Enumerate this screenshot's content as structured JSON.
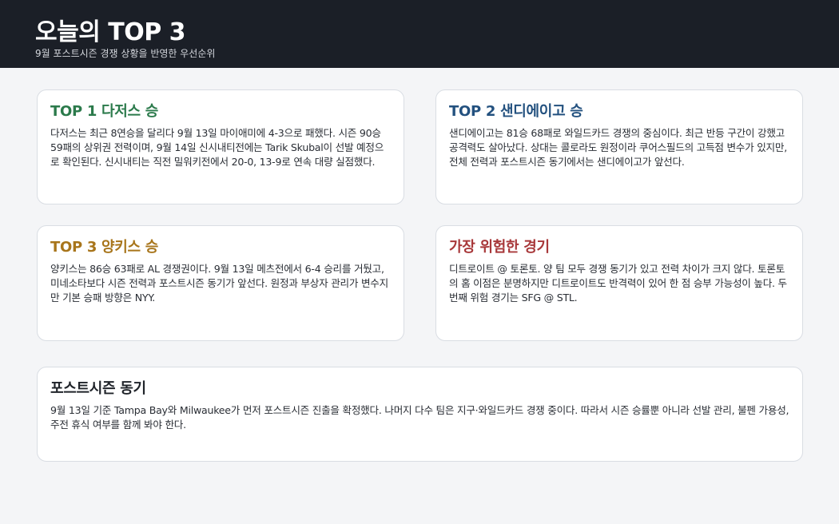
{
  "header": {
    "title": "오늘의 TOP 3",
    "subtitle": "9월 포스트시즌 경쟁 상황을 반영한 우선순위"
  },
  "cards": [
    {
      "title": "TOP 1  다저스 승",
      "body": "다저스는 최근 8연승을 달리다 9월 13일 마이애미에 4-3으로 패했다. 시즌 90승 59패의 상위권 전력이며, 9월 14일 신시내티전에는 Tarik Skubal이 선발 예정으로 확인된다. 신시내티는 직전 밀워키전에서 20-0, 13-9로 연속 대량 실점했다."
    },
    {
      "title": "TOP 2  샌디에이고 승",
      "body": "샌디에이고는 81승 68패로 와일드카드 경쟁의 중심이다. 최근 반등 구간이 강했고 공격력도 살아났다. 상대는 콜로라도 원정이라 쿠어스필드의 고득점 변수가 있지만, 전체 전력과 포스트시즌 동기에서는 샌디에이고가 앞선다."
    },
    {
      "title": "TOP 3  양키스 승",
      "body": "양키스는 86승 63패로 AL 경쟁권이다. 9월 13일 메츠전에서 6-4 승리를 거뒀고, 미네소타보다 시즌 전력과 포스트시즌 동기가 앞선다. 원정과 부상자 관리가 변수지만 기본 승패 방향은 NYY."
    },
    {
      "title": "가장 위험한 경기",
      "body": "디트로이트 @ 토론토. 양 팀 모두 경쟁 동기가 있고 전력 차이가 크지 않다. 토론토의 홈 이점은 분명하지만 디트로이트도 반격력이 있어 한 점 승부 가능성이 높다. 두 번째 위험 경기는 SFG @ STL."
    },
    {
      "title": "포스트시즌 동기",
      "body": "9월 13일 기준 Tampa Bay와 Milwaukee가 먼저 포스트시즌 진출을 확정했다. 나머지 다수 팀은 지구·와일드카드 경쟁 중이다. 따라서 시즌 승률뿐 아니라 선발 관리, 불펜 가용성, 주전 휴식 여부를 함께 봐야 한다."
    }
  ],
  "colors": {
    "header_bg": "#1b1f27",
    "top1": "#2b7a4b",
    "top2": "#23517f",
    "top3": "#a8751b",
    "risk": "#a8383a"
  }
}
